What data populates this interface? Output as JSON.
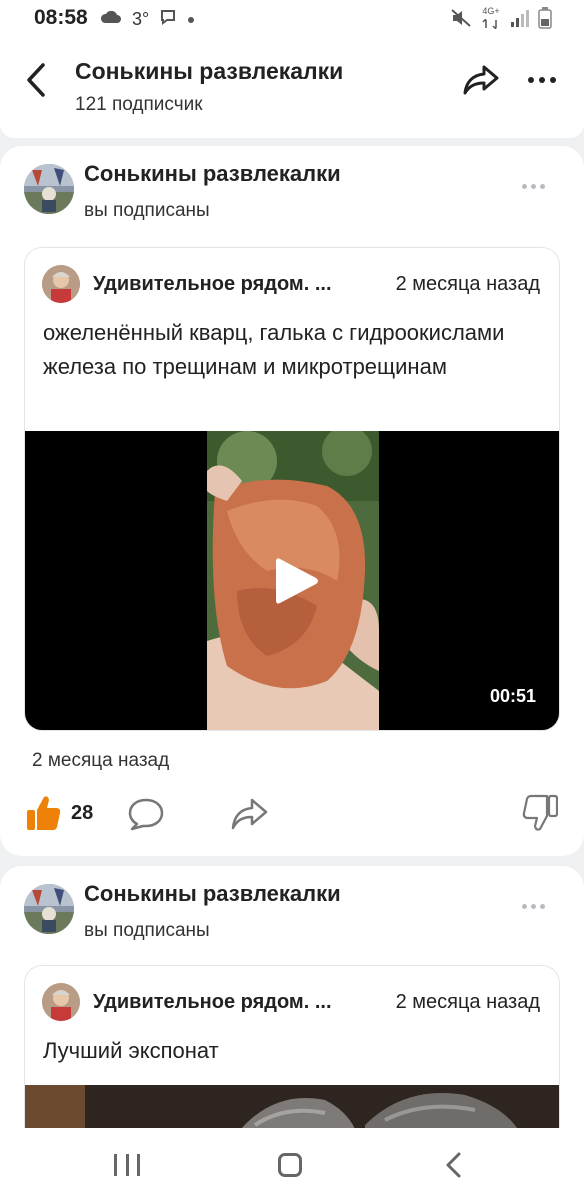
{
  "status_bar": {
    "time": "08:58",
    "temperature": "3°",
    "network": "4G+",
    "icons": [
      "cloud-icon",
      "message-icon",
      "dot-icon",
      "mute-icon",
      "network-4g-icon",
      "signal-icon",
      "battery-icon"
    ]
  },
  "header": {
    "title": "Сонькины развлекалки",
    "subscribers": "121 подписчик",
    "icons": [
      "back-arrow-icon",
      "share-icon",
      "more-icon"
    ]
  },
  "posts": [
    {
      "group_name": "Сонькины развлекалки",
      "subscription": "вы подписаны",
      "repost": {
        "source_name": "Удивительное рядом. ...",
        "source_time": "2 месяца назад",
        "text": "ожеленённый кварц, галька с гидроокислами железа по трещинам и микротрещинам",
        "video_duration": "00:51"
      },
      "time": "2 месяца назад",
      "likes": "28"
    },
    {
      "group_name": "Сонькины развлекалки",
      "subscription": "вы подписаны",
      "repost": {
        "source_name": "Удивительное рядом. ...",
        "source_time": "2 месяца назад",
        "text": "Лучший экспонат"
      }
    }
  ],
  "colors": {
    "like_accent": "#ee8208",
    "background": "#eef0f2",
    "card": "#ffffff"
  }
}
